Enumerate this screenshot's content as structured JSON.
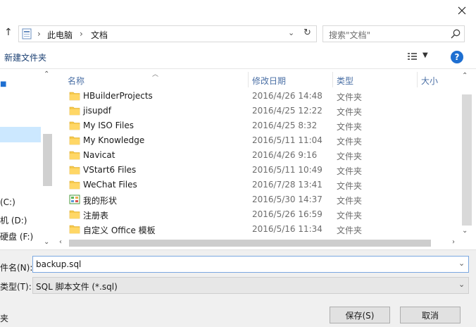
{
  "address": {
    "crumbs": [
      "此电脑",
      "文档"
    ],
    "search_placeholder": "搜索\"文档\""
  },
  "toolbar": {
    "new_folder": "新建文件夹"
  },
  "nav": {
    "drive_c": "(C:)",
    "drive_d": "机 (D:)",
    "drive_f": "硬盘 (F:)"
  },
  "columns": {
    "name": "名称",
    "date": "修改日期",
    "type": "类型",
    "size": "大小"
  },
  "files": [
    {
      "name": "HBuilderProjects",
      "date": "2016/4/26 14:48",
      "type": "文件夹",
      "icon": "folder-icon"
    },
    {
      "name": "jisupdf",
      "date": "2016/4/25 12:22",
      "type": "文件夹",
      "icon": "folder-icon"
    },
    {
      "name": "My ISO Files",
      "date": "2016/4/25 8:32",
      "type": "文件夹",
      "icon": "folder-icon"
    },
    {
      "name": "My Knowledge",
      "date": "2016/5/11 11:04",
      "type": "文件夹",
      "icon": "folder-icon"
    },
    {
      "name": "Navicat",
      "date": "2016/4/26 9:16",
      "type": "文件夹",
      "icon": "folder-icon"
    },
    {
      "name": "VStart6 Files",
      "date": "2016/5/11 10:49",
      "type": "文件夹",
      "icon": "folder-icon"
    },
    {
      "name": "WeChat Files",
      "date": "2016/7/28 13:41",
      "type": "文件夹",
      "icon": "folder-icon"
    },
    {
      "name": "我的形状",
      "date": "2016/5/30 14:37",
      "type": "文件夹",
      "icon": "shapes-folder-icon"
    },
    {
      "name": "注册表",
      "date": "2016/5/26 16:59",
      "type": "文件夹",
      "icon": "folder-icon"
    },
    {
      "name": "自定义 Office 模板",
      "date": "2016/5/16 11:34",
      "type": "文件夹",
      "icon": "folder-icon"
    }
  ],
  "form": {
    "filename_label": "件名(N):",
    "filename_value": "backup.sql",
    "filetype_label": "类型(T):",
    "filetype_value": "SQL 脚本文件 (*.sql)",
    "hide_folders": "夹"
  },
  "buttons": {
    "save": "保存(S)",
    "cancel": "取消"
  },
  "colors": {
    "folder": "#f6c94c",
    "accent": "#1e6fd1",
    "selection": "#cce8ff"
  }
}
